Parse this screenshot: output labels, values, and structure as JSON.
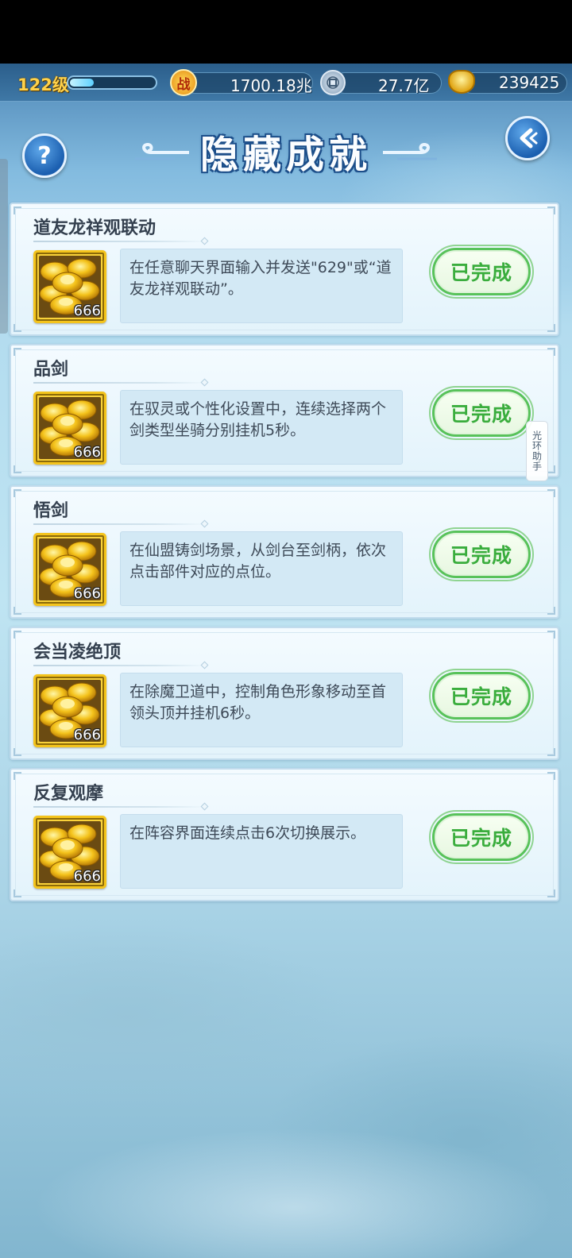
{
  "status_bar": {
    "level": "122级",
    "xp_fraction": 0.28,
    "power_value": "1700.18兆",
    "power_icon_glyph": "战",
    "coin_value": "27.7亿",
    "ingot_value": "239425"
  },
  "header": {
    "title": "隐藏成就",
    "help_glyph": "?"
  },
  "achievements": [
    {
      "title": "道友龙祥观联动",
      "description": "在任意聊天界面输入并发送\"629\"或“道友龙祥观联动”。",
      "reward_count": "666",
      "status": "已完成"
    },
    {
      "title": "品剑",
      "description": "在驭灵或个性化设置中，连续选择两个剑类型坐骑分别挂机5秒。",
      "reward_count": "666",
      "status": "已完成"
    },
    {
      "title": "悟剑",
      "description": "在仙盟铸剑场景，从剑台至剑柄，依次点击部件对应的点位。",
      "reward_count": "666",
      "status": "已完成"
    },
    {
      "title": "会当凌绝顶",
      "description": "在除魔卫道中，控制角色形象移动至首领头顶并挂机6秒。",
      "reward_count": "666",
      "status": "已完成"
    },
    {
      "title": "反复观摩",
      "description": "在阵容界面连续点击6次切换展示。",
      "reward_count": "666",
      "status": "已完成"
    }
  ],
  "helper": {
    "label": "光环助手"
  },
  "colors": {
    "complete_green": "#3aad3d",
    "title_blue": "#1d4f8a",
    "gold": "#f9d23a"
  }
}
